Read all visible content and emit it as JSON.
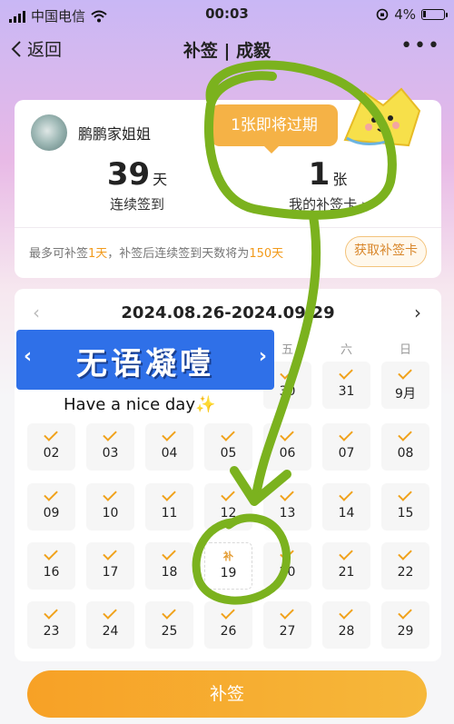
{
  "status_bar": {
    "carrier": "中国电信",
    "time": "00:03",
    "battery": "4%"
  },
  "nav": {
    "back_label": "返回",
    "title": "补签 | 成毅",
    "more": "•••"
  },
  "profile": {
    "name": "鹏鹏家姐姐"
  },
  "expire_badge": "1张即将过期",
  "stats": {
    "streak_value": "39",
    "streak_unit": "天",
    "streak_label": "连续签到",
    "cards_value": "1",
    "cards_unit": "张",
    "cards_label": "我的补签卡 ›"
  },
  "note": {
    "p1": "最多可补签",
    "v1": "1天",
    "p2": "，补签后连续签到天数将为",
    "v2": "150天"
  },
  "get_card_button": "获取补签卡",
  "calendar": {
    "range": "2024.08.26-2024.09.29",
    "prev": "‹",
    "next": "›",
    "weekdays": {
      "fri": "五",
      "sat": "六",
      "sun": "日"
    },
    "row1": [
      "30",
      "31",
      "9月"
    ],
    "row2": [
      "02",
      "03",
      "04",
      "05",
      "06",
      "07",
      "08"
    ],
    "row3": [
      "09",
      "10",
      "11",
      "12",
      "13",
      "14",
      "15"
    ],
    "row4": [
      "16",
      "17",
      "18",
      "19",
      "20",
      "21",
      "22"
    ],
    "row5": [
      "23",
      "24",
      "25",
      "26",
      "27",
      "28",
      "29"
    ],
    "makeup_tag": "补"
  },
  "overlay": {
    "title": "无语凝噎",
    "left_arrow": "‹",
    "right_arrow": "›",
    "subtitle": "Have a nice day",
    "sparkle": "✨"
  },
  "makeup_button": "补签",
  "colors": {
    "accent": "#f5a623",
    "ink_green": "#7bb21e",
    "banner_blue": "#2f70e8"
  }
}
